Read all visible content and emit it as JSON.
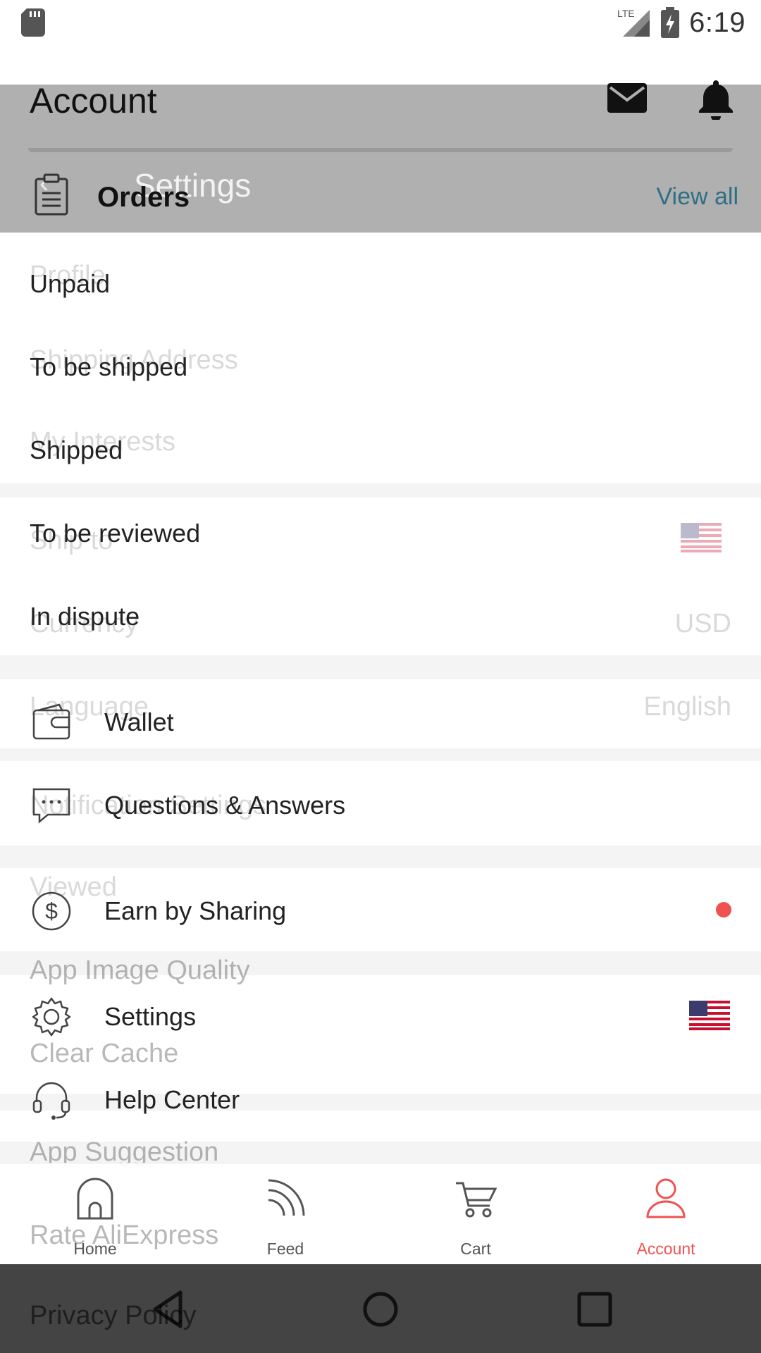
{
  "status_bar": {
    "time": "6:19",
    "network": "LTE"
  },
  "header": {
    "title": "Account"
  },
  "settings_overlay": {
    "title": "Settings",
    "items": [
      "Profile",
      "Shipping Address",
      "My Interests",
      "Ship to",
      "Currency",
      "Language",
      "Notification Settings",
      "Viewed",
      "App Image Quality",
      "Clear Cache",
      "App Suggestion",
      "Rate AliExpress",
      "Privacy Policy"
    ],
    "currency_value": "USD",
    "language_value": "English"
  },
  "orders": {
    "title": "Orders",
    "view_all": "View all",
    "statuses": [
      "Unpaid",
      "To be shipped",
      "Shipped",
      "To be reviewed",
      "In dispute"
    ]
  },
  "menu": {
    "wallet": "Wallet",
    "qa": "Questions & Answers",
    "earn": "Earn by Sharing",
    "settings": "Settings",
    "help": "Help Center"
  },
  "bottom_nav": [
    "Home",
    "Feed",
    "Cart",
    "Account"
  ],
  "colors": {
    "accent": "#f0524f",
    "link": "#2f6f85",
    "dim": "#b0b0b0"
  },
  "icons": [
    "sd-card-icon",
    "signal-icon",
    "battery-icon",
    "mail-icon",
    "bell-icon",
    "back-icon",
    "clipboard-icon",
    "wallet-icon",
    "chat-bubble-icon",
    "dollar-icon",
    "gear-icon",
    "headset-icon",
    "us-flag-icon",
    "home-icon",
    "feed-icon",
    "cart-icon",
    "person-icon",
    "nav-back-icon",
    "nav-home-icon",
    "nav-recents-icon"
  ]
}
